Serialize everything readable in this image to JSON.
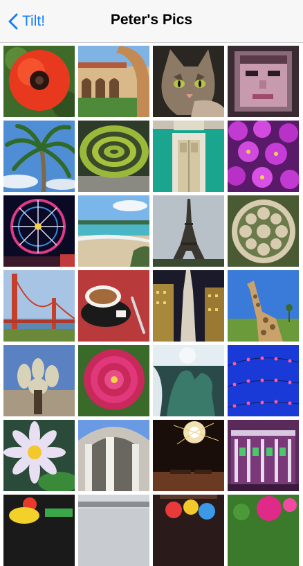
{
  "navbar": {
    "back_label": "Tilt!",
    "title": "Peter's Pics"
  },
  "photos": [
    {
      "subject": "red poppy flower"
    },
    {
      "subject": "stanford arcade courtyard"
    },
    {
      "subject": "tabby cat"
    },
    {
      "subject": "pixel mosaic face"
    },
    {
      "subject": "palm tree"
    },
    {
      "subject": "hedge maze garden"
    },
    {
      "subject": "green building door"
    },
    {
      "subject": "purple flowers"
    },
    {
      "subject": "ferris wheel at night"
    },
    {
      "subject": "beach coastline"
    },
    {
      "subject": "eiffel tower"
    },
    {
      "subject": "rose window carving"
    },
    {
      "subject": "golden gate bridge"
    },
    {
      "subject": "espresso cup"
    },
    {
      "subject": "skyscraper street"
    },
    {
      "subject": "giraffe"
    },
    {
      "subject": "cholla cactus"
    },
    {
      "subject": "pink dahlia"
    },
    {
      "subject": "fountain sculpture"
    },
    {
      "subject": "string lights night"
    },
    {
      "subject": "white water lily"
    },
    {
      "subject": "dome columns"
    },
    {
      "subject": "fireworks night"
    },
    {
      "subject": "columned building facade"
    },
    {
      "subject": "yellow toy"
    },
    {
      "subject": "gray sky"
    },
    {
      "subject": "colorful cocktails"
    },
    {
      "subject": "pink flowers"
    }
  ]
}
